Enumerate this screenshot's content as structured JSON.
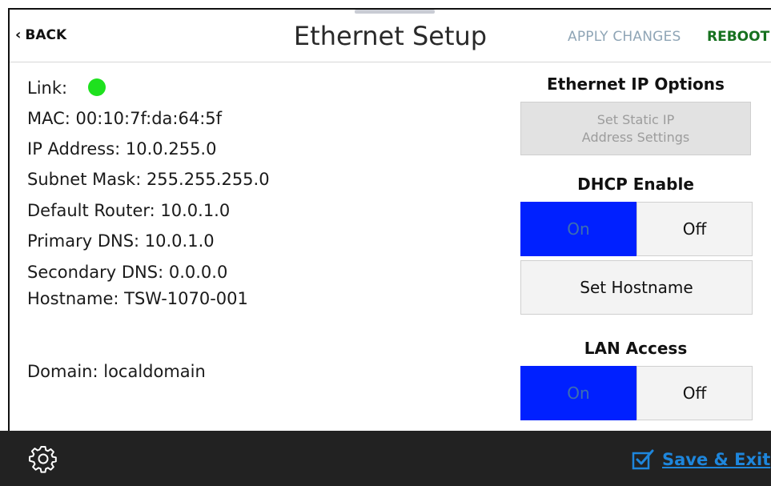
{
  "header": {
    "back_label": "BACK",
    "title": "Ethernet Setup",
    "apply_label": "APPLY CHANGES",
    "reboot_label": "REBOOT"
  },
  "info": {
    "link_label": "Link:",
    "link_status_color": "#1ee11e",
    "mac": "MAC: 00:10:7f:da:64:5f",
    "ip": "IP Address: 10.0.255.0",
    "subnet": "Subnet Mask: 255.255.255.0",
    "router": "Default Router: 10.0.1.0",
    "primary_dns": "Primary DNS: 10.0.1.0",
    "secondary_dns": "Secondary DNS: 0.0.0.0",
    "hostname": "Hostname: TSW-1070-001",
    "domain": "Domain: localdomain"
  },
  "options": {
    "ip_options_heading": "Ethernet IP Options",
    "static_ip_line1": "Set Static IP",
    "static_ip_line2": "Address Settings",
    "dhcp_heading": "DHCP Enable",
    "dhcp_on": "On",
    "dhcp_off": "Off",
    "dhcp_selected": "On",
    "set_hostname": "Set Hostname",
    "lan_heading": "LAN Access",
    "lan_on": "On",
    "lan_off": "Off",
    "lan_selected": "On"
  },
  "footer": {
    "settings_icon": "gear-icon",
    "save_exit_label": "Save & Exit",
    "save_icon": "checkbox-check-icon"
  },
  "colors": {
    "selected_toggle": "#0020ff",
    "reboot": "#16711f",
    "apply_disabled": "#8fa5b6",
    "link_accent": "#1e86dc",
    "footer_bg": "#222222"
  }
}
